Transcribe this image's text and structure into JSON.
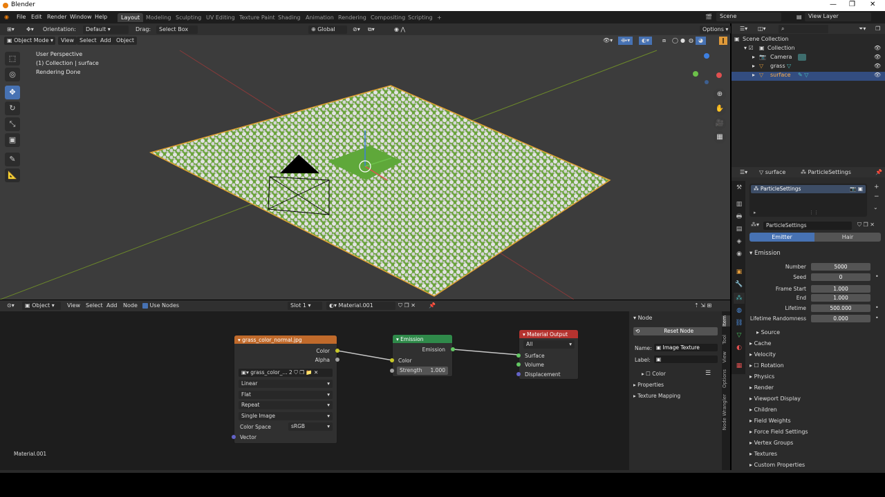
{
  "window": {
    "title": "Blender",
    "min": "—",
    "max": "❐",
    "close": "✕"
  },
  "menu": [
    "File",
    "Edit",
    "Render",
    "Window",
    "Help"
  ],
  "workspaces": [
    "Layout",
    "Modeling",
    "Sculpting",
    "UV Editing",
    "Texture Paint",
    "Shading",
    "Animation",
    "Rendering",
    "Compositing",
    "Scripting"
  ],
  "add_tab": "+",
  "scene": {
    "label": "Scene",
    "view_layer": "View Layer"
  },
  "viewport_header": {
    "orientation_label": "Orientation:",
    "orientation_value": "Default",
    "drag_label": "Drag:",
    "drag_value": "Select Box",
    "transform": "Global",
    "options": "Options",
    "mode": "Object Mode",
    "view": "View",
    "select": "Select",
    "add": "Add",
    "object": "Object"
  },
  "viewport_overlay": {
    "line1": "User Perspective",
    "line2": "(1) Collection | surface",
    "line3": "Rendering Done"
  },
  "tool_icons": [
    "cursor-select-icon",
    "cursor-3d-icon",
    "move-icon",
    "rotate-icon",
    "scale-icon",
    "transform-icon",
    "annotate-icon",
    "measure-icon"
  ],
  "tool_glyphs": [
    "⬚",
    "◎",
    "✥",
    "↻",
    "⤡",
    "▣",
    "✎",
    "📐"
  ],
  "nav_glyphs": [
    "⊕",
    "✋",
    "🎥",
    "▦"
  ],
  "node_editor_header": {
    "type": "Object",
    "view": "View",
    "select": "Select",
    "add": "Add",
    "node": "Node",
    "use_nodes": "Use Nodes",
    "slot": "Slot 1",
    "material": "Material.001"
  },
  "nodes": {
    "image_texture": {
      "title": "grass_color_normal.jpg",
      "out_color": "Color",
      "out_alpha": "Alpha",
      "image_name": "grass_color_...",
      "users": "2",
      "interpolation": "Linear",
      "projection": "Flat",
      "extension": "Repeat",
      "source": "Single Image",
      "color_space_label": "Color Space",
      "color_space": "sRGB",
      "in_vector": "Vector"
    },
    "emission": {
      "title": "Emission",
      "out": "Emission",
      "in_color": "Color",
      "strength_label": "Strength",
      "strength": "1.000"
    },
    "output": {
      "title": "Material Output",
      "target": "All",
      "surface": "Surface",
      "volume": "Volume",
      "displacement": "Displacement"
    }
  },
  "node_editor_footer": "Material.001",
  "node_panel": {
    "title": "Node",
    "reset": "Reset Node",
    "name_label": "Name:",
    "name_value": "Image Texture",
    "label_label": "Label:",
    "color": "Color",
    "properties": "Properties",
    "texture_mapping": "Texture Mapping",
    "tabs": [
      "Item",
      "Tool",
      "View",
      "Options",
      "Node Wrangler"
    ]
  },
  "outliner": {
    "root": "Scene Collection",
    "collection": "Collection",
    "items": [
      "Camera",
      "grass",
      "surface"
    ]
  },
  "properties": {
    "breadcrumb_object": "surface",
    "breadcrumb_settings": "ParticleSettings",
    "list_item": "ParticleSettings",
    "datablock": "ParticleSettings",
    "emitter": "Emitter",
    "hair": "Hair",
    "emission_title": "Emission",
    "fields": [
      {
        "label": "Number",
        "value": "5000"
      },
      {
        "label": "Seed",
        "value": "0"
      },
      {
        "label": "Frame Start",
        "value": "1.000"
      },
      {
        "label": "End",
        "value": "1.000"
      },
      {
        "label": "Lifetime",
        "value": "500.000"
      },
      {
        "label": "Lifetime Randomness",
        "value": "0.000"
      }
    ],
    "source": "Source",
    "sections": [
      "Cache",
      "Velocity",
      "Rotation",
      "Physics",
      "Render",
      "Viewport Display",
      "Children",
      "Field Weights",
      "Force Field Settings",
      "Vertex Groups",
      "Textures",
      "Custom Properties"
    ]
  },
  "colors": {
    "accent": "#4772b3",
    "texture_header": "#c06a2b",
    "emission_header": "#2f8a4a",
    "output_header": "#b5332f",
    "grass": "#6aa33c"
  }
}
